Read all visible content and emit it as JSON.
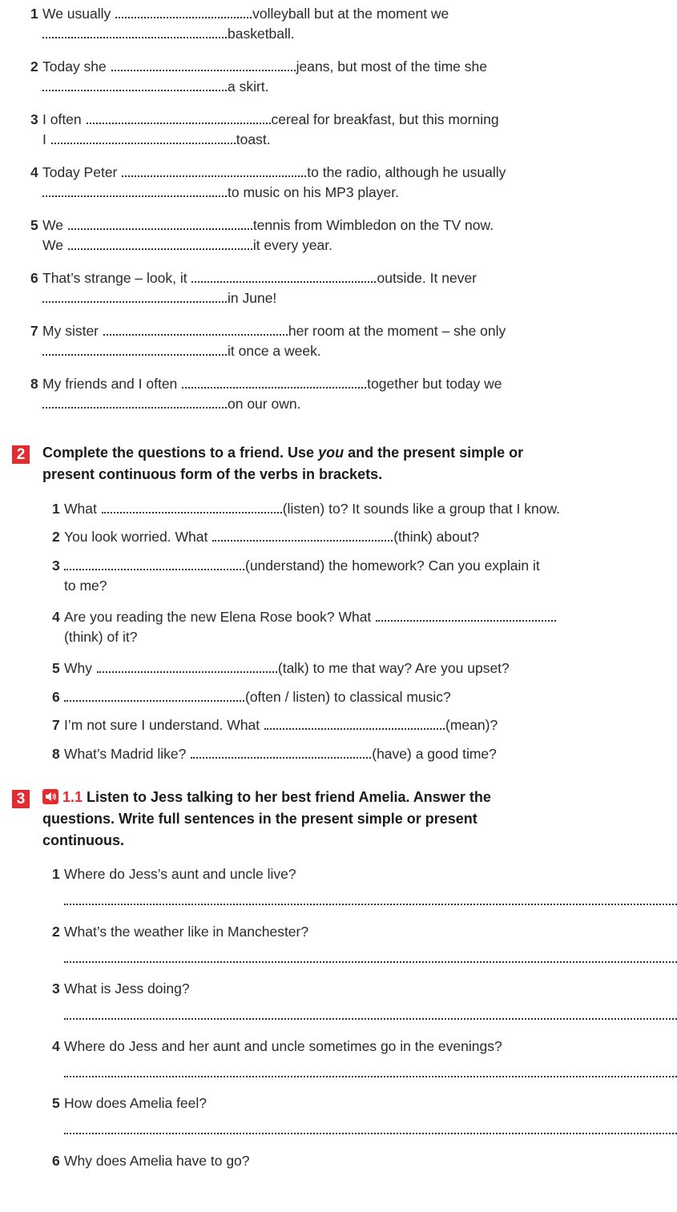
{
  "ex1": {
    "items": [
      {
        "num": "1",
        "l1a": "We usually",
        "l1b": "volleyball but at the moment we",
        "l2b": "basketball."
      },
      {
        "num": "2",
        "l1a": "Today she",
        "l1b": "jeans, but most of the time she",
        "l2b": "a skirt."
      },
      {
        "num": "3",
        "l1a": "I often",
        "l1b": "cereal for breakfast, but this morning",
        "l2a": "I",
        "l2b": "toast."
      },
      {
        "num": "4",
        "l1a": "Today Peter",
        "l1b": "to the radio, although he usually",
        "l2b": "to music on his MP3 player."
      },
      {
        "num": "5",
        "l1a": "We",
        "l1b": "tennis from Wimbledon on the TV now.",
        "l2a": "We",
        "l2b": "it every year."
      },
      {
        "num": "6",
        "l1a": "That’s strange – look, it",
        "l1b": "outside. It never",
        "l2b": "in June!"
      },
      {
        "num": "7",
        "l1a": "My sister",
        "l1b": "her room at the moment – she only",
        "l2b": "it once a week."
      },
      {
        "num": "8",
        "l1a": "My friends and I often",
        "l1b": "together but today we",
        "l2b": "on our own."
      }
    ]
  },
  "ex2": {
    "number": "2",
    "instr_a": "Complete the questions to a friend. Use ",
    "instr_em": "you",
    "instr_b": " and the present simple or",
    "instr_line2": "present continuous form of the verbs in brackets.",
    "items": [
      {
        "num": "1",
        "a": "What",
        "b": "(listen) to? It sounds like a group that I know."
      },
      {
        "num": "2",
        "a": "You look worried. What",
        "b": "(think) about?"
      },
      {
        "num": "3",
        "b": "(understand) the homework? Can you explain it",
        "c": "to me?"
      },
      {
        "num": "4",
        "a": "Are you reading the new Elena Rose book? What",
        "c": "(think) of it?"
      },
      {
        "num": "5",
        "a": "Why",
        "b": "(talk) to me that way? Are you upset?"
      },
      {
        "num": "6",
        "b": "(often / listen) to classical music?"
      },
      {
        "num": "7",
        "a": "I’m not sure I understand. What",
        "b": "(mean)?"
      },
      {
        "num": "8",
        "a": "What’s Madrid like?",
        "b": "(have) a good time?"
      }
    ]
  },
  "ex3": {
    "number": "3",
    "track": "1.1",
    "instr_a": "Listen to Jess talking to her best friend Amelia. Answer the",
    "instr_line2": "questions. Write full sentences in the present simple or present",
    "instr_line3": "continuous.",
    "icon": "audio-speaker-icon",
    "questions": [
      {
        "num": "1",
        "text": "Where do Jess’s aunt and uncle live?"
      },
      {
        "num": "2",
        "text": "What’s the weather like in Manchester?"
      },
      {
        "num": "3",
        "text": "What is Jess doing?"
      },
      {
        "num": "4",
        "text": "Where do Jess and her aunt and uncle sometimes go in the evenings?"
      },
      {
        "num": "5",
        "text": "How does Amelia feel?"
      },
      {
        "num": "6",
        "text": "Why does Amelia have to go?"
      }
    ]
  }
}
